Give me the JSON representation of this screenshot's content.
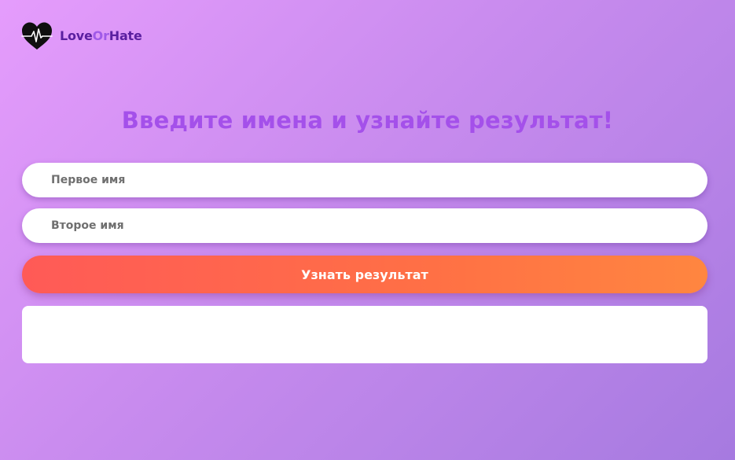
{
  "logo": {
    "icon": "heart-pulse-icon",
    "text_love": "Love",
    "text_or": "Or",
    "text_hate": "Hate"
  },
  "heading": "Введите имена и узнайте результат!",
  "form": {
    "first_name_placeholder": "Первое имя",
    "first_name_value": "",
    "second_name_placeholder": "Второе имя",
    "second_name_value": "",
    "submit_label": "Узнать результат"
  },
  "result": {
    "text": ""
  },
  "colors": {
    "heading": "#a450ea",
    "logo_dark": "#5a1fa0",
    "logo_accent": "#a05ae8",
    "button_start": "#ff5a57",
    "button_end": "#ff8640"
  }
}
